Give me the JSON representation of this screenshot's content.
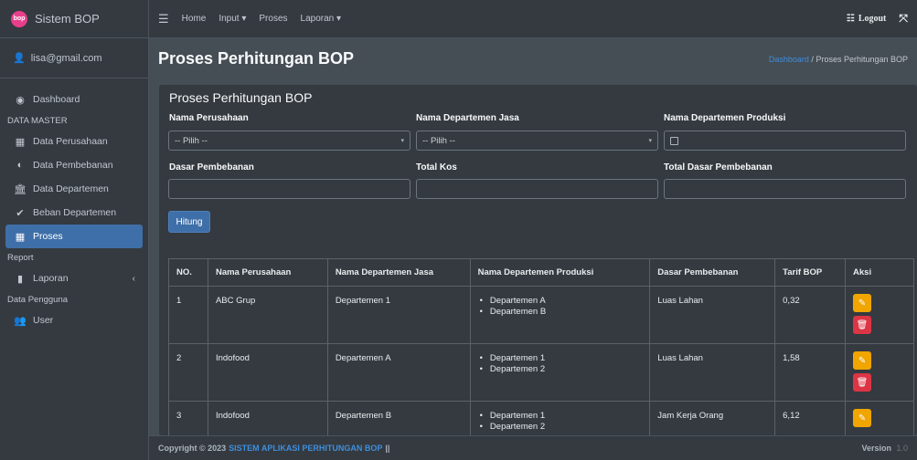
{
  "sidebar": {
    "brand": "Sistem BOP",
    "logo_text": "bop",
    "user_email": "lisa@gmail.com",
    "dashboard": "Dashboard",
    "header_master": "DATA MASTER",
    "data_perusahaan": "Data Perusahaan",
    "data_pembebanan": "Data Pembebanan",
    "data_departemen": "Data Departemen",
    "beban_departemen": "Beban Departemen",
    "proses": "Proses",
    "header_report": "Report",
    "laporan": "Laporan",
    "header_pengguna": "Data Pengguna",
    "user": "User"
  },
  "topbar": {
    "home": "Home",
    "input": "Input ▾",
    "proses": "Proses",
    "laporan": "Laporan ▾",
    "logout": "Logout"
  },
  "header": {
    "title": "Proses Perhitungan BOP",
    "crumb_link": "Dashboard",
    "crumb_sep": "/",
    "crumb_current": "Proses Perhitungan BOP"
  },
  "form": {
    "title": "Proses Perhitungan BOP",
    "label_perusahaan": "Nama Perusahaan",
    "label_dept_jasa": "Nama Departemen Jasa",
    "label_dept_produksi": "Nama Departemen Produksi",
    "perusahaan_value": "-- Pilih --",
    "dept_jasa_value": "-- Pilih --",
    "label_dasar": "Dasar Pembebanan",
    "label_total_kos": "Total Kos",
    "label_total_dasar": "Total Dasar Pembebanan",
    "button_hitung": "Hitung"
  },
  "table": {
    "headers": [
      "NO.",
      "Nama Perusahaan",
      "Nama Departemen Jasa",
      "Nama Departemen Produksi",
      "Dasar Pembebanan",
      "Tarif BOP",
      "Aksi"
    ],
    "rows": [
      {
        "no": "1",
        "perusahaan": "ABC Grup",
        "dept_jasa": "Departemen 1",
        "produksi": [
          "Departemen A",
          "Departemen B"
        ],
        "dasar": "Luas Lahan",
        "tarif": "0,32"
      },
      {
        "no": "2",
        "perusahaan": "Indofood",
        "dept_jasa": "Departemen A",
        "produksi": [
          "Departemen 1",
          "Departemen 2"
        ],
        "dasar": "Luas Lahan",
        "tarif": "1,58"
      },
      {
        "no": "3",
        "perusahaan": "Indofood",
        "dept_jasa": "Departemen B",
        "produksi": [
          "Departemen 1",
          "Departemen 2"
        ],
        "dasar": "Jam Kerja Orang",
        "tarif": "6,12"
      }
    ]
  },
  "footer": {
    "copyright": "Copyright © 2023",
    "app_name": "SISTEM APLIKASI PERHITUNGAN BOP",
    "sep": "||",
    "version_label": "Version",
    "version_num": "1.0"
  },
  "colors": {
    "sidebar_bg": "#343a40",
    "content_bg": "#454d55",
    "primary": "#3f6fa8",
    "warning": "#f0a500",
    "danger": "#dc3545",
    "link": "#3f8edc"
  }
}
